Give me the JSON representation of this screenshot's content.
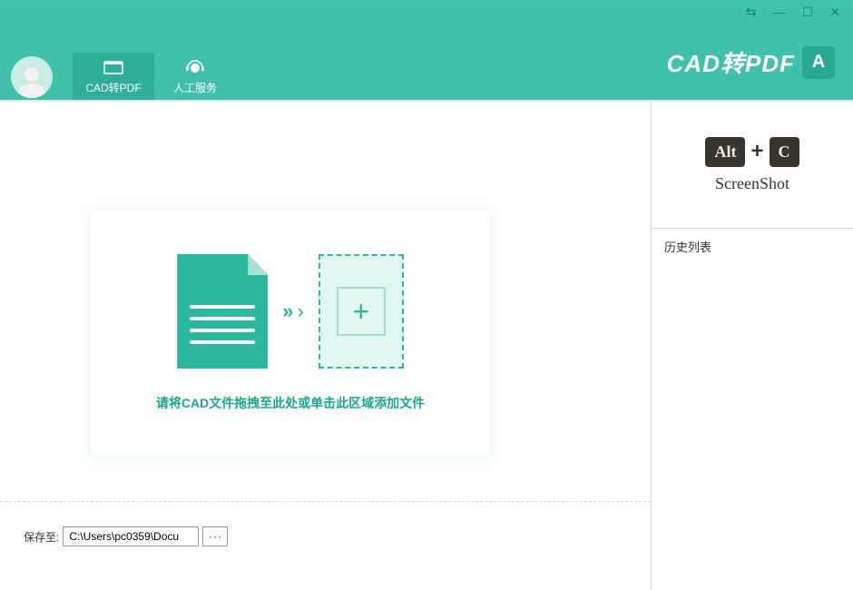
{
  "app": {
    "title": "CAD转PDF",
    "logo_letter": "A"
  },
  "tabs": {
    "cad_to_pdf": "CAD转PDF",
    "human_service": "人工服务"
  },
  "dropzone": {
    "hint": "请将CAD文件拖拽至此处或单击此区域添加文件"
  },
  "promo": {
    "key1": "Alt",
    "plus": "+",
    "key2": "C",
    "label": "ScreenShot"
  },
  "history": {
    "header": "历史列表"
  },
  "save": {
    "label": "保存至:",
    "path": "C:\\Users\\pc0359\\Docu",
    "browse": "···"
  },
  "window_controls": {
    "menu": "⇆",
    "minimize": "—",
    "maximize": "☐",
    "close": "✕"
  }
}
